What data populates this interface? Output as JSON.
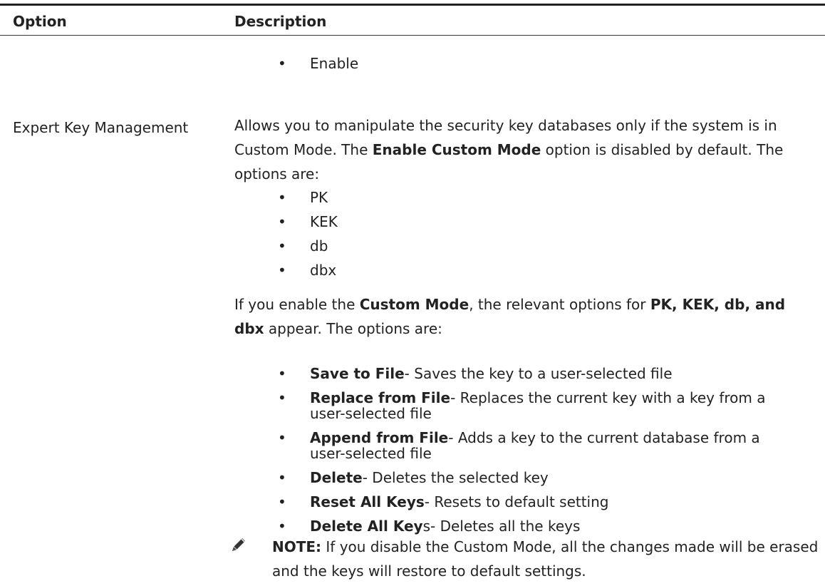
{
  "table": {
    "headers": {
      "option": "Option",
      "description": "Description"
    },
    "prev_item": "Enable",
    "option_name": "Expert Key Management",
    "intro": {
      "t1": "Allows you to manipulate the security key databases only if the system is in Custom Mode. The ",
      "b1": "Enable Custom Mode",
      "t2": " option is disabled by default. The options are:"
    },
    "key_databases": [
      "PK",
      "KEK",
      "db",
      "dbx"
    ],
    "custom_mode": {
      "t1": "If you enable the ",
      "b1": "Custom Mode",
      "t2": ", the relevant options for ",
      "b2": "PK, KEK, db, and dbx",
      "t3": " appear. The options are:"
    },
    "actions": [
      {
        "label": "Save to File",
        "text": "- Saves the key to a user-selected file"
      },
      {
        "label": "Replace from File",
        "text": "- Replaces the current key with a key from a user-selected file"
      },
      {
        "label": "Append from File",
        "text": "- Adds a key to the current database from a user-selected file"
      },
      {
        "label": "Delete",
        "text": "- Deletes the selected key"
      },
      {
        "label": "Reset All Keys",
        "text": "- Resets to default setting"
      },
      {
        "label": "Delete All Key",
        "text": "s- Deletes all the keys"
      }
    ],
    "note": {
      "label": "NOTE:",
      "text": " If you disable the Custom Mode, all the changes made will be erased and the keys will restore to default settings."
    }
  },
  "icons": {
    "bullet": "bullet-dot",
    "note": "pencil-note-icon"
  }
}
